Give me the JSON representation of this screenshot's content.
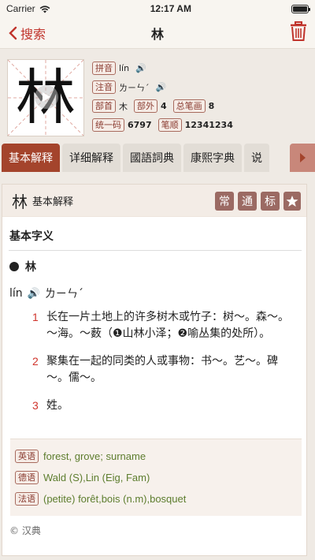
{
  "status": {
    "carrier": "Carrier",
    "time": "12:17 AM",
    "battery_level": 1.0
  },
  "nav": {
    "back_label": "搜索",
    "title": "林"
  },
  "character": {
    "glyph": "林",
    "pinyin_label": "拼音",
    "pinyin": "lín",
    "zhuyin_label": "注音",
    "zhuyin": "ㄌㄧㄣˊ",
    "radical_label": "部首",
    "radical": "木",
    "outside_label": "部外",
    "outside": "4",
    "total_label": "总笔画",
    "total": "8",
    "unicode_label": "统一码",
    "unicode": "6797",
    "stroke_label": "笔顺",
    "stroke_order": "12341234"
  },
  "tabs": [
    "基本解释",
    "详细解释",
    "國語詞典",
    "康熙字典",
    "说"
  ],
  "active_tab": 0,
  "content": {
    "header_char": "林",
    "header_sub": "基本解释",
    "badges": [
      "常",
      "通",
      "标"
    ],
    "section_title": "基本字义",
    "entry_char": "林",
    "pron_pinyin": "lín",
    "pron_zhuyin": "ㄌㄧㄣˊ",
    "definitions": [
      {
        "num": "1",
        "text": "长在一片土地上的许多树木或竹子：树～。森～。～海。～薮（❶山林小泽；❷喻丛集的处所）。"
      },
      {
        "num": "2",
        "text": "聚集在一起的同类的人或事物：书～。艺～。碑～。儒～。"
      },
      {
        "num": "3",
        "text": "姓。"
      }
    ],
    "translations": [
      {
        "lang": "英语",
        "text": "forest, grove; surname"
      },
      {
        "lang": "德语",
        "text": "Wald (S),Lin (Eig, Fam)"
      },
      {
        "lang": "法语",
        "text": "(petite) forêt,bois (n.m),bosquet"
      }
    ],
    "copyright": "© 汉典"
  },
  "colors": {
    "accent": "#c0332b",
    "tab_active": "#a4442c",
    "badge": "#9b6a63",
    "translation_text": "#5d7d2e"
  }
}
